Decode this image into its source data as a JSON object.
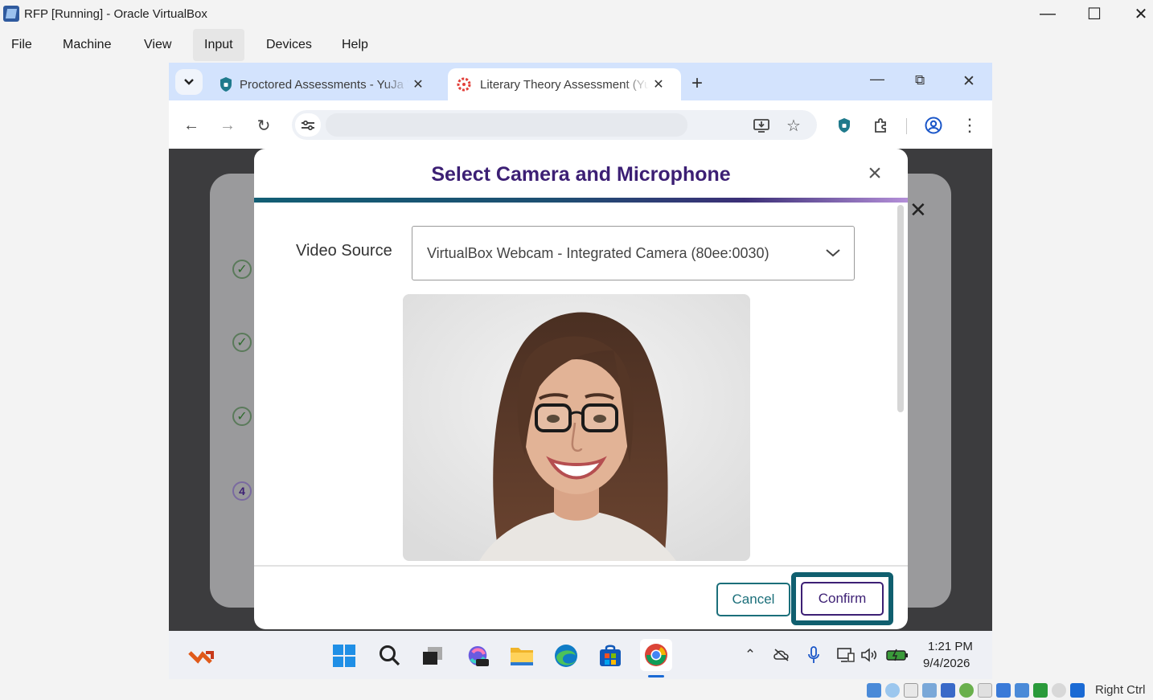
{
  "vbox": {
    "window_title": "RFP [Running] - Oracle VirtualBox",
    "menu": [
      "File",
      "Machine",
      "View",
      "Input",
      "Devices",
      "Help"
    ],
    "active_menu": "Input",
    "host_key": "Right Ctrl"
  },
  "chrome": {
    "tabs": [
      {
        "title": "Proctored Assessments - YuJa Verity",
        "icon": "yuja-shield-icon",
        "active": false
      },
      {
        "title": "Literary Theory Assessment (YuJa",
        "icon": "canvas-logo-icon",
        "active": true
      }
    ],
    "url": ""
  },
  "modal": {
    "title": "Select Camera and Microphone",
    "video_source_label": "Video Source",
    "video_source_value": "VirtualBox Webcam - Integrated Camera (80ee:0030)",
    "cancel_label": "Cancel",
    "confirm_label": "Confirm"
  },
  "background": {
    "step_number": "4"
  },
  "taskbar": {
    "time": "1:21 PM",
    "date": "9/4/2026",
    "apps": [
      "start-icon",
      "search-icon",
      "task-view-icon",
      "m365-copilot-icon",
      "file-explorer-icon",
      "edge-icon",
      "store-icon",
      "chrome-icon"
    ]
  },
  "colors": {
    "modal_title": "#3c1f74",
    "accent_teal": "#1b6f7a",
    "highlight": "#105f6f",
    "tabstrip": "#d3e3fd"
  }
}
